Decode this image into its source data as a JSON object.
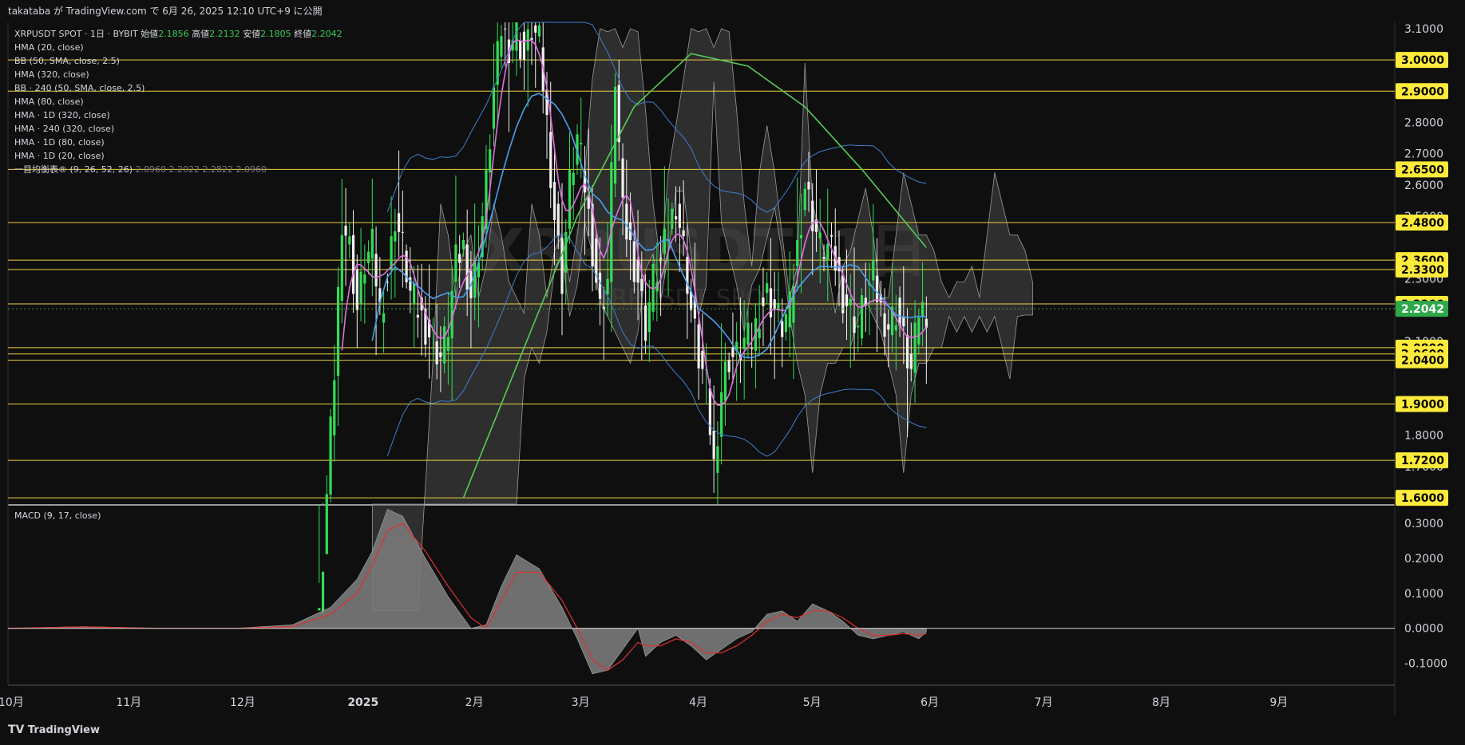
{
  "header": {
    "publish_text": "takataba が TradingView.com で 6月 26, 2025 12:10 UTC+9 に公開"
  },
  "legend": {
    "symbol": "XRPUSDT SPOT · 1日 · BYBIT",
    "open_label": "始値",
    "open": "2.1856",
    "high_label": "高値",
    "high": "2.2132",
    "low_label": "安値",
    "low": "2.1805",
    "close_label": "終値",
    "close": "2.2042",
    "indicators": [
      "HMA (20, close)",
      "BB (50, SMA, close, 2.5)",
      "HMA (320, close)",
      "BB · 240 (50, SMA, close, 2.5)",
      "HMA (80, close)",
      "HMA · 1D (320, close)",
      "HMA · 240 (320, close)",
      "HMA · 1D (80, close)",
      "HMA · 1D (20, close)"
    ],
    "ichimoku_label": "一目均衡表® (9, 26, 52, 26)",
    "ichimoku_values": "2.0960  2.2022  2.2822  2.0960"
  },
  "watermark": {
    "main": "XRPUSDT, 1日",
    "sub": "XRPUSDT SPOT"
  },
  "macd_label": "MACD (9, 17, close)",
  "footer": {
    "logo_text": "TradingView"
  },
  "colors": {
    "background": "#0f0f0f",
    "up_candle": "#33dd55",
    "down_candle": "#f0f0f0",
    "hma20": "#e070e0",
    "hma80": "#4aa0f0",
    "hma320": "#55cc55",
    "bb_band": "#3d7fd0",
    "cloud": "#888888",
    "level_line": "#f0d040",
    "level_label_bg": "#ffeb3b",
    "current_label_bg": "#2ea84a",
    "macd_hist": "#7a7a7a",
    "macd_signal": "#e03030"
  },
  "chart_data": {
    "type": "candlestick",
    "symbol": "XRPUSDT",
    "timeframe": "1日",
    "ylim": [
      1.58,
      3.12
    ],
    "y_ticks": [
      "3.1000",
      "2.8000",
      "2.7000",
      "2.6000",
      "2.5000",
      "2.3000",
      "2.1000",
      "1.8000",
      "1.7000"
    ],
    "x_ticks": [
      "10月",
      "11月",
      "12月",
      "2025",
      "2月",
      "3月",
      "4月",
      "5月",
      "6月",
      "7月",
      "8月",
      "9月"
    ],
    "x_tick_days": [
      0,
      31,
      61,
      92,
      123,
      151,
      182,
      212,
      243,
      273,
      304,
      335
    ],
    "levels": [
      3.0,
      2.9,
      2.65,
      2.48,
      2.36,
      2.33,
      2.22,
      2.08,
      2.06,
      2.04,
      1.9,
      1.72,
      1.6
    ],
    "level_labels": [
      "3.0000",
      "2.9000",
      "2.6500",
      "2.4800",
      "2.3600",
      "2.3300",
      "2.2200",
      "2.0800",
      "2.0600",
      "2.0400",
      "1.9000",
      "1.7200",
      "1.6000"
    ],
    "current_price": 2.2042,
    "current_price_label": "2.2042",
    "price_points": [
      [
        82,
        1.2
      ],
      [
        84,
        1.6
      ],
      [
        86,
        2.0
      ],
      [
        88,
        2.5
      ],
      [
        90,
        2.4
      ],
      [
        92,
        2.2
      ],
      [
        94,
        2.35
      ],
      [
        96,
        2.4
      ],
      [
        98,
        2.2
      ],
      [
        100,
        2.3
      ],
      [
        102,
        2.5
      ],
      [
        104,
        2.4
      ],
      [
        106,
        2.25
      ],
      [
        108,
        2.2
      ],
      [
        110,
        2.15
      ],
      [
        112,
        2.1
      ],
      [
        114,
        2.05
      ],
      [
        116,
        2.15
      ],
      [
        118,
        2.35
      ],
      [
        120,
        2.4
      ],
      [
        122,
        2.25
      ],
      [
        124,
        2.4
      ],
      [
        126,
        2.6
      ],
      [
        128,
        2.9
      ],
      [
        130,
        3.1
      ],
      [
        132,
        3.05
      ],
      [
        134,
        3.1
      ],
      [
        136,
        3.0
      ],
      [
        138,
        3.1
      ],
      [
        140,
        3.05
      ],
      [
        142,
        2.8
      ],
      [
        144,
        2.5
      ],
      [
        146,
        2.3
      ],
      [
        148,
        2.6
      ],
      [
        150,
        2.75
      ],
      [
        152,
        2.6
      ],
      [
        154,
        2.4
      ],
      [
        156,
        2.2
      ],
      [
        158,
        2.3
      ],
      [
        160,
        2.95
      ],
      [
        162,
        2.5
      ],
      [
        164,
        2.4
      ],
      [
        166,
        2.3
      ],
      [
        168,
        2.15
      ],
      [
        170,
        2.3
      ],
      [
        172,
        2.35
      ],
      [
        174,
        2.45
      ],
      [
        176,
        2.55
      ],
      [
        178,
        2.4
      ],
      [
        180,
        2.2
      ],
      [
        182,
        2.05
      ],
      [
        184,
        1.95
      ],
      [
        186,
        1.7
      ],
      [
        188,
        1.95
      ],
      [
        190,
        2.05
      ],
      [
        192,
        2.05
      ],
      [
        194,
        2.1
      ],
      [
        196,
        2.1
      ],
      [
        198,
        2.2
      ],
      [
        200,
        2.25
      ],
      [
        202,
        2.2
      ],
      [
        204,
        2.15
      ],
      [
        206,
        2.2
      ],
      [
        208,
        2.4
      ],
      [
        210,
        2.6
      ],
      [
        212,
        2.5
      ],
      [
        214,
        2.4
      ],
      [
        216,
        2.4
      ],
      [
        218,
        2.35
      ],
      [
        220,
        2.25
      ],
      [
        222,
        2.2
      ],
      [
        224,
        2.15
      ],
      [
        226,
        2.25
      ],
      [
        228,
        2.3
      ],
      [
        230,
        2.2
      ],
      [
        232,
        2.15
      ],
      [
        234,
        2.2
      ],
      [
        236,
        2.1
      ],
      [
        238,
        2.0
      ],
      [
        240,
        2.2
      ],
      [
        242,
        2.2042
      ]
    ],
    "macd": {
      "ylim": [
        -0.16,
        0.35
      ],
      "y_ticks": [
        "0.3000",
        "0.2000",
        "0.1000",
        "0.0000",
        "-0.1000"
      ],
      "hist": [
        [
          0,
          0.0
        ],
        [
          20,
          0.005
        ],
        [
          40,
          0.0
        ],
        [
          60,
          0.0
        ],
        [
          75,
          0.01
        ],
        [
          85,
          0.06
        ],
        [
          92,
          0.14
        ],
        [
          96,
          0.22
        ],
        [
          100,
          0.34
        ],
        [
          104,
          0.32
        ],
        [
          110,
          0.2
        ],
        [
          116,
          0.09
        ],
        [
          122,
          0.0
        ],
        [
          126,
          0.01
        ],
        [
          130,
          0.12
        ],
        [
          134,
          0.21
        ],
        [
          140,
          0.17
        ],
        [
          146,
          0.06
        ],
        [
          150,
          -0.03
        ],
        [
          154,
          -0.13
        ],
        [
          158,
          -0.12
        ],
        [
          162,
          -0.06
        ],
        [
          166,
          0.0
        ],
        [
          168,
          -0.08
        ],
        [
          172,
          -0.04
        ],
        [
          176,
          -0.02
        ],
        [
          180,
          -0.05
        ],
        [
          184,
          -0.09
        ],
        [
          188,
          -0.06
        ],
        [
          192,
          -0.03
        ],
        [
          196,
          -0.01
        ],
        [
          200,
          0.04
        ],
        [
          204,
          0.05
        ],
        [
          208,
          0.02
        ],
        [
          212,
          0.07
        ],
        [
          216,
          0.05
        ],
        [
          220,
          0.02
        ],
        [
          224,
          -0.02
        ],
        [
          228,
          -0.03
        ],
        [
          232,
          -0.02
        ],
        [
          236,
          -0.01
        ],
        [
          240,
          -0.03
        ],
        [
          242,
          -0.01
        ]
      ],
      "signal": [
        [
          0,
          0.0
        ],
        [
          20,
          0.004
        ],
        [
          40,
          0.0
        ],
        [
          60,
          0.0
        ],
        [
          75,
          0.005
        ],
        [
          85,
          0.04
        ],
        [
          92,
          0.1
        ],
        [
          96,
          0.18
        ],
        [
          100,
          0.28
        ],
        [
          104,
          0.3
        ],
        [
          110,
          0.22
        ],
        [
          116,
          0.12
        ],
        [
          122,
          0.03
        ],
        [
          126,
          0.0
        ],
        [
          130,
          0.08
        ],
        [
          134,
          0.16
        ],
        [
          140,
          0.16
        ],
        [
          146,
          0.08
        ],
        [
          150,
          0.0
        ],
        [
          154,
          -0.09
        ],
        [
          158,
          -0.12
        ],
        [
          162,
          -0.09
        ],
        [
          166,
          -0.04
        ],
        [
          168,
          -0.05
        ],
        [
          172,
          -0.05
        ],
        [
          176,
          -0.03
        ],
        [
          180,
          -0.04
        ],
        [
          184,
          -0.07
        ],
        [
          188,
          -0.07
        ],
        [
          192,
          -0.05
        ],
        [
          196,
          -0.02
        ],
        [
          200,
          0.02
        ],
        [
          204,
          0.04
        ],
        [
          208,
          0.03
        ],
        [
          212,
          0.05
        ],
        [
          216,
          0.05
        ],
        [
          220,
          0.03
        ],
        [
          224,
          0.0
        ],
        [
          228,
          -0.02
        ],
        [
          232,
          -0.02
        ],
        [
          236,
          -0.015
        ],
        [
          240,
          -0.02
        ],
        [
          242,
          -0.015
        ]
      ]
    }
  }
}
